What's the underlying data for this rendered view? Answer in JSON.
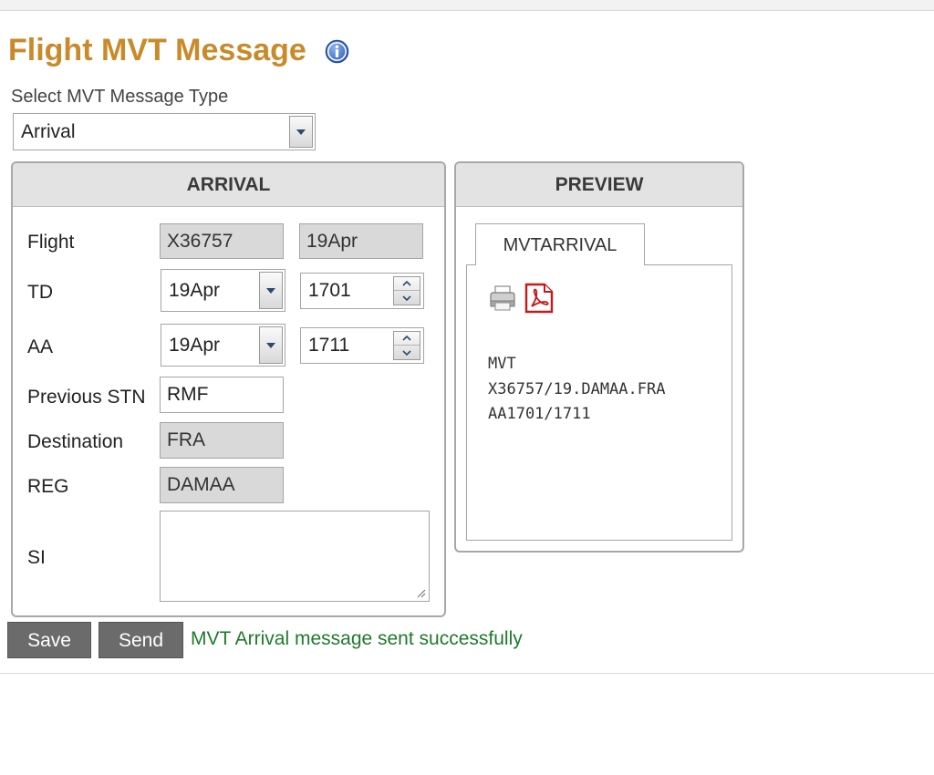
{
  "page": {
    "title": "Flight MVT Message",
    "info_icon": "info-icon"
  },
  "message_type": {
    "label": "Select MVT Message Type",
    "selected": "Arrival"
  },
  "arrival": {
    "header": "ARRIVAL",
    "flight": {
      "label": "Flight",
      "number": "X36757",
      "date": "19Apr"
    },
    "td": {
      "label": "TD",
      "date": "19Apr",
      "time": "1701"
    },
    "aa": {
      "label": "AA",
      "date": "19Apr",
      "time": "1711"
    },
    "previous_stn": {
      "label": "Previous STN",
      "value": "RMF"
    },
    "destination": {
      "label": "Destination",
      "value": "FRA"
    },
    "reg": {
      "label": "REG",
      "value": "DAMAA"
    },
    "si": {
      "label": "SI",
      "value": ""
    }
  },
  "preview": {
    "header": "PREVIEW",
    "tab_label": "MVTARRIVAL",
    "icons": [
      "print-icon",
      "pdf-icon"
    ],
    "message_lines": [
      "MVT",
      "X36757/19.DAMAA.FRA",
      "AA1701/1711"
    ]
  },
  "actions": {
    "save_label": "Save",
    "send_label": "Send",
    "status_message": "MVT Arrival message sent successfully"
  },
  "colors": {
    "title": "#c98a2a",
    "status_success": "#1f7a2a",
    "button_bg": "#6b6b6b",
    "panel_header_bg": "#e3e3e3",
    "readonly_bg": "#d9d9d9"
  }
}
